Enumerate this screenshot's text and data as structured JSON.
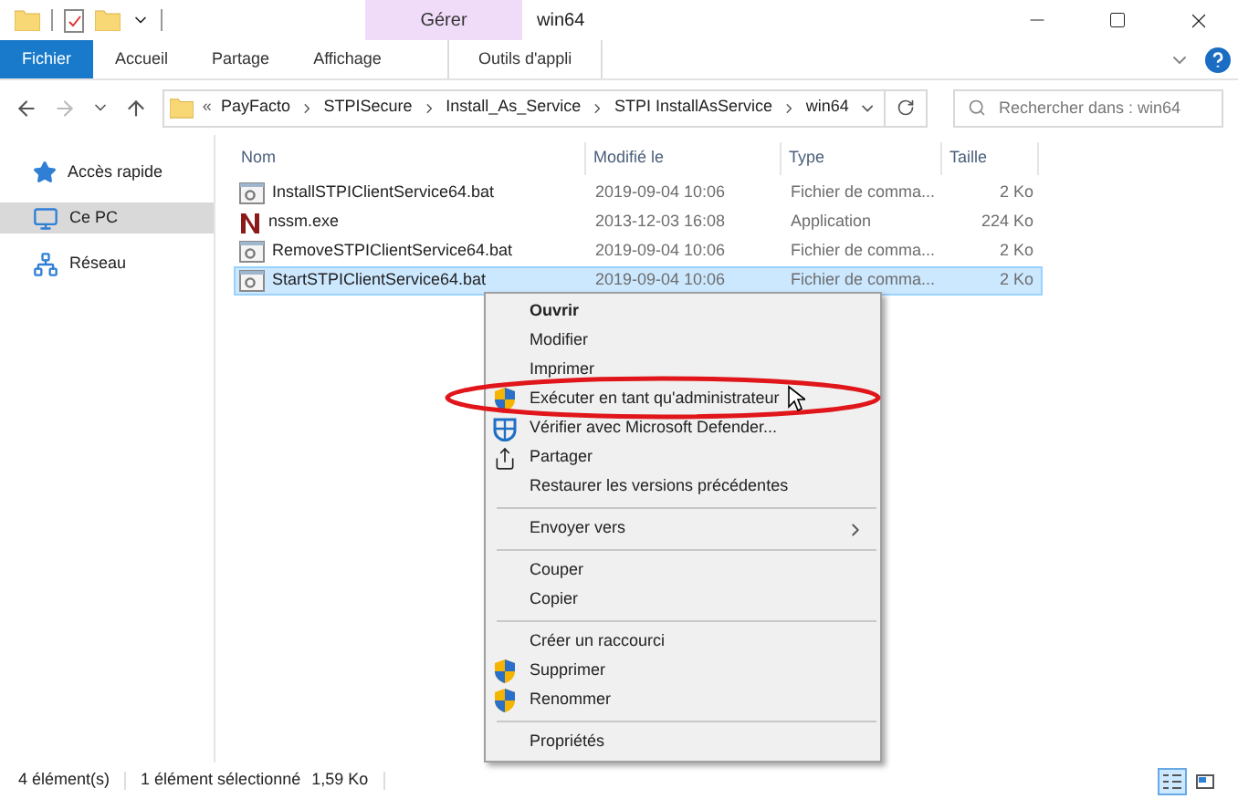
{
  "title_bar": {
    "contextual_tab": "Gérer",
    "title": "win64"
  },
  "ribbon_tabs": [
    {
      "label": "Fichier",
      "kind": "file"
    },
    {
      "label": "Accueil",
      "kind": "normal"
    },
    {
      "label": "Partage",
      "kind": "normal"
    },
    {
      "label": "Affichage",
      "kind": "normal"
    },
    {
      "label": "Outils d'appli",
      "kind": "contextual"
    }
  ],
  "address_bar": {
    "overflow": "«",
    "path": [
      "PayFacto",
      "STPISecure",
      "Install_As_Service",
      "STPI InstallAsService",
      "win64"
    ]
  },
  "search": {
    "placeholder": "Rechercher dans : win64"
  },
  "sidebar": {
    "items": [
      {
        "label": "Accès rapide",
        "kind": "quick_access",
        "selected": false
      },
      {
        "label": "Ce PC",
        "kind": "computer",
        "selected": true
      },
      {
        "label": "Réseau",
        "kind": "network",
        "selected": false
      }
    ]
  },
  "table": {
    "columns": [
      "Nom",
      "Modifié le",
      "Type",
      "Taille"
    ],
    "rows": [
      {
        "name": "InstallSTPIClientService64.bat",
        "kind": "batch",
        "modified": "2019-09-04 10:06",
        "type": "Fichier de comma...",
        "size": "2 Ko",
        "selected": false
      },
      {
        "name": "nssm.exe",
        "kind": "application",
        "modified": "2013-12-03 16:08",
        "type": "Application",
        "size": "224 Ko",
        "selected": false
      },
      {
        "name": "RemoveSTPIClientService64.bat",
        "kind": "batch",
        "modified": "2019-09-04 10:06",
        "type": "Fichier de comma...",
        "size": "2 Ko",
        "selected": false
      },
      {
        "name": "StartSTPIClientService64.bat",
        "kind": "batch",
        "modified": "2019-09-04 10:06",
        "type": "Fichier de comma...",
        "size": "2 Ko",
        "selected": true
      }
    ]
  },
  "context_menu": {
    "items": [
      {
        "kind": "item",
        "label": "Ouvrir",
        "bold": true,
        "submenu": false
      },
      {
        "kind": "item",
        "label": "Modifier",
        "bold": false,
        "submenu": false
      },
      {
        "kind": "item",
        "label": "Imprimer",
        "bold": false,
        "submenu": false
      },
      {
        "kind": "admin",
        "label": "Exécuter en tant qu'administrateur",
        "bold": false,
        "submenu": false
      },
      {
        "kind": "scan",
        "label": "Vérifier avec Microsoft Defender...",
        "bold": false,
        "submenu": false
      },
      {
        "kind": "share",
        "label": "Partager",
        "bold": false,
        "submenu": false
      },
      {
        "kind": "item",
        "label": "Restaurer les versions précédentes",
        "bold": false,
        "submenu": false
      },
      {
        "kind": "separator"
      },
      {
        "kind": "item",
        "label": "Envoyer vers",
        "bold": false,
        "submenu": true
      },
      {
        "kind": "separator"
      },
      {
        "kind": "item",
        "label": "Couper",
        "bold": false,
        "submenu": false
      },
      {
        "kind": "item",
        "label": "Copier",
        "bold": false,
        "submenu": false
      },
      {
        "kind": "separator"
      },
      {
        "kind": "item",
        "label": "Créer un raccourci",
        "bold": false,
        "submenu": false
      },
      {
        "kind": "admin",
        "label": "Supprimer",
        "bold": false,
        "submenu": false
      },
      {
        "kind": "admin",
        "label": "Renommer",
        "bold": false,
        "submenu": false
      },
      {
        "kind": "separator"
      },
      {
        "kind": "item",
        "label": "Propriétés",
        "bold": false,
        "submenu": false
      }
    ]
  },
  "annotation": {
    "kind": "ellipse",
    "color": "#e0161b"
  },
  "status_bar": {
    "texts": [
      "4 élément(s)",
      "1 élément sélectionné",
      "1,59 Ko"
    ],
    "view_buttons": [
      {
        "kind": "details",
        "selected": true
      },
      {
        "kind": "tiles",
        "selected": false
      }
    ]
  }
}
